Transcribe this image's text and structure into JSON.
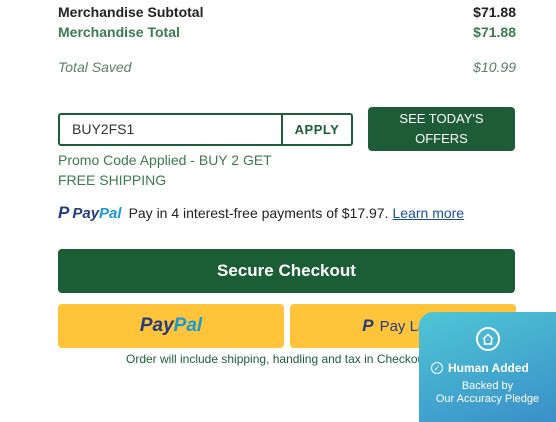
{
  "summary": {
    "subtotal_label": "Merchandise Subtotal",
    "subtotal_value": "$71.88",
    "total_label": "Merchandise Total",
    "total_value": "$71.88",
    "saved_label": "Total Saved",
    "saved_value": "$10.99"
  },
  "promo": {
    "input_value": "BUY2FS1",
    "apply_label": "APPLY",
    "offers_label": "SEE TODAY'S OFFERS",
    "applied_message": "Promo Code Applied - BUY 2 GET FREE SHIPPING"
  },
  "paypal_message": {
    "brand_a": "Pay",
    "brand_b": "Pal",
    "text": "Pay in 4 interest-free payments of $17.97.",
    "link": "Learn more"
  },
  "checkout": {
    "secure_label": "Secure Checkout",
    "paypal_a": "Pay",
    "paypal_b": "Pal",
    "pay_later_label": "Pay Later",
    "order_note": "Order will include shipping, handling and tax in Checkout."
  },
  "badge": {
    "title": "Human Added",
    "line1": "Backed by",
    "line2": "Our Accuracy Pledge"
  },
  "colors": {
    "brand_green": "#1b5e36",
    "paypal_yellow": "#ffc439",
    "paypal_navy": "#253b80",
    "paypal_blue": "#179bd7"
  }
}
